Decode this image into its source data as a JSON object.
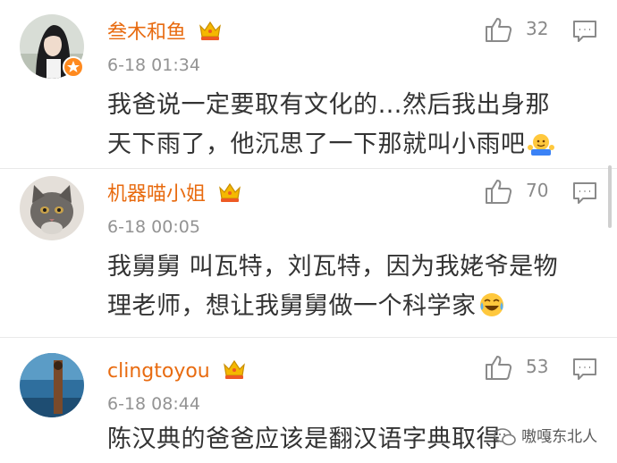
{
  "comments": [
    {
      "username": "叁木和鱼",
      "time": "6-18 01:34",
      "likes": "32",
      "text": "我爸说一定要取有文化的…然后我出身那天下雨了，他沉思了一下那就叫小雨吧",
      "emoji": "shrug-emoji",
      "avatar": "girl-photo-avatar",
      "verified_badge": true
    },
    {
      "username": "机器喵小姐",
      "time": "6-18 00:05",
      "likes": "70",
      "text": "我舅舅 叫瓦特，刘瓦特，因为我姥爷是物理老师，想让我舅舅做一个科学家",
      "emoji": "laugh-cry-emoji",
      "avatar": "cat-photo-avatar"
    },
    {
      "username": "clingtoyou",
      "time": "6-18 08:44",
      "likes": "53",
      "text": "陈汉典的爸爸应该是翻汉语字典取得",
      "avatar": "blue-photo-avatar"
    }
  ],
  "icons": {
    "like": "thumbs-up-icon",
    "reply": "comment-bubble-icon",
    "member": "crown-icon"
  },
  "colors": {
    "username": "#e86b10",
    "badge": "#ff8a1f",
    "meta": "#939393",
    "text": "#333333"
  },
  "watermark": "嗷嘎东北人"
}
